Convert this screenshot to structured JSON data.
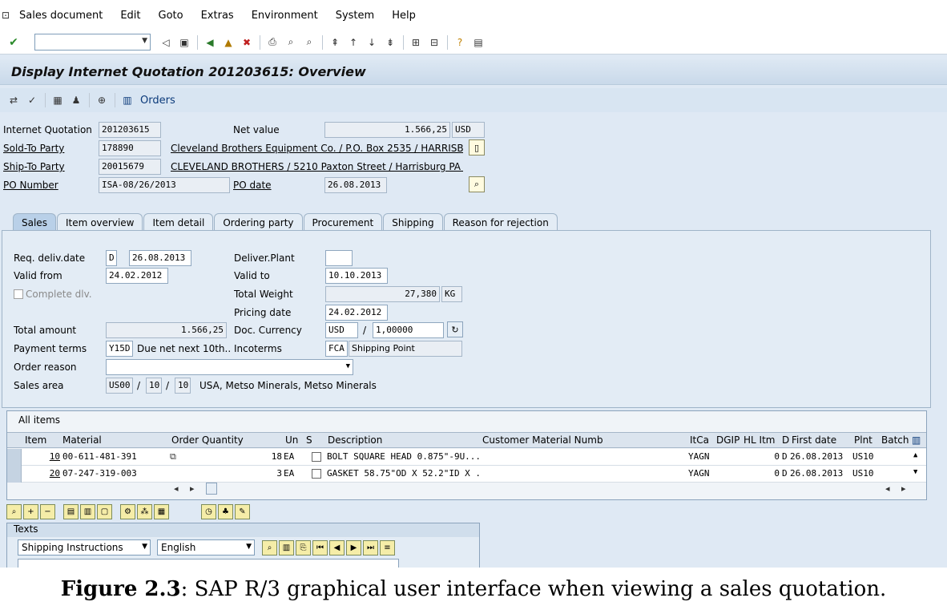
{
  "menu": [
    "Sales document",
    "Edit",
    "Goto",
    "Extras",
    "Environment",
    "System",
    "Help"
  ],
  "title": "Display Internet Quotation 201203615: Overview",
  "appbar": {
    "orders_label": "Orders"
  },
  "header": {
    "internet_quotation_label": "Internet Quotation",
    "internet_quotation_value": "201203615",
    "net_value_label": "Net value",
    "net_value": "1.566,25",
    "net_currency": "USD",
    "sold_to_label": "Sold-To Party",
    "sold_to_value": "178890",
    "sold_to_text": "Cleveland Brothers Equipment Co. / P.O. Box 2535 / HARRISB...",
    "ship_to_label": "Ship-To Party",
    "ship_to_value": "20015679",
    "ship_to_text": "CLEVELAND BROTHERS / 5210 Paxton Street / Harrisburg PA ...",
    "po_number_label": "PO Number",
    "po_number_value": "ISA-08/26/2013",
    "po_date_label": "PO date",
    "po_date_value": "26.08.2013"
  },
  "tabs": [
    "Sales",
    "Item overview",
    "Item detail",
    "Ordering party",
    "Procurement",
    "Shipping",
    "Reason for rejection"
  ],
  "sales": {
    "req_deliv_label": "Req. deliv.date",
    "req_deliv_flag": "D",
    "req_deliv_value": "26.08.2013",
    "deliver_plant_label": "Deliver.Plant",
    "valid_from_label": "Valid from",
    "valid_from_value": "24.02.2012",
    "valid_to_label": "Valid to",
    "valid_to_value": "10.10.2013",
    "complete_dlv_label": "Complete dlv.",
    "total_weight_label": "Total Weight",
    "total_weight_value": "27,380",
    "total_weight_unit": "KG",
    "pricing_date_label": "Pricing date",
    "pricing_date_value": "24.02.2012",
    "total_amount_label": "Total amount",
    "total_amount_value": "1.566,25",
    "doc_currency_label": "Doc. Currency",
    "doc_currency_value": "USD",
    "exchange_rate_value": "1,00000",
    "payment_terms_label": "Payment terms",
    "payment_terms_code": "Y15D",
    "payment_terms_text": "Due net next 10th...",
    "incoterms_label": "Incoterms",
    "incoterms_code": "FCA",
    "incoterms_text": "Shipping Point",
    "order_reason_label": "Order reason",
    "sales_area_label": "Sales area",
    "sales_org": "US00",
    "dist_channel": "10",
    "division": "10",
    "sales_area_text": "USA, Metso Minerals, Metso Minerals"
  },
  "items": {
    "title": "All items",
    "columns": [
      "Item",
      "Material",
      "Order Quantity",
      "Un",
      "S",
      "Description",
      "Customer Material Numb",
      "ItCa",
      "DGIP",
      "HL Itm",
      "D",
      "First date",
      "Plnt",
      "Batch"
    ],
    "rows": [
      {
        "item": "10",
        "material": "00-611-481-391",
        "qty": "18",
        "un": "EA",
        "desc": "BOLT SQUARE HEAD 0.875\"-9U...",
        "itca": "YAGN",
        "hl": "0",
        "d": "D",
        "date": "26.08.2013",
        "plnt": "US10"
      },
      {
        "item": "20",
        "material": "07-247-319-003",
        "qty": "3",
        "un": "EA",
        "desc": "GASKET 58.75\"OD X 52.2\"ID X ...",
        "itca": "YAGN",
        "hl": "0",
        "d": "D",
        "date": "26.08.2013",
        "plnt": "US10"
      }
    ]
  },
  "texts": {
    "title": "Texts",
    "text_type": "Shipping Instructions",
    "language": "English"
  },
  "caption": {
    "label": "Figure 2.3",
    "text": ": SAP R/3 graphical user interface when viewing a sales quotation."
  }
}
